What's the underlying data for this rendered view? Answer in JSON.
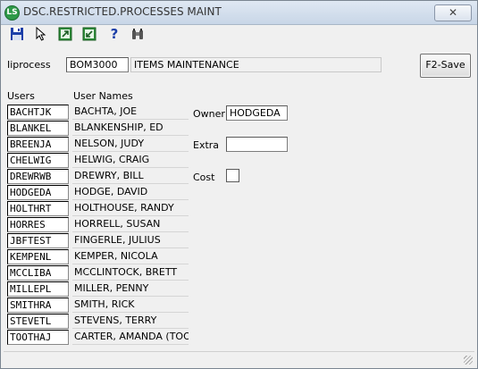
{
  "window": {
    "title": "DSC.RESTRICTED.PROCESSES MAINT",
    "app_icon_letter": "LS",
    "close_label": "✕"
  },
  "toolbar": {
    "icons": [
      "save-icon",
      "pointer-icon",
      "export-icon",
      "import-icon",
      "help-icon",
      "binoculars-icon"
    ],
    "help_glyph": "?"
  },
  "header": {
    "process_label": "Iiprocess",
    "process_value": "BOM3000",
    "process_desc": "ITEMS MAINTENANCE",
    "save_button": "F2-Save"
  },
  "grid": {
    "users_header": "Users",
    "names_header": "User Names",
    "rows": [
      {
        "user": "BACHTJK",
        "name": "BACHTA, JOE"
      },
      {
        "user": "BLANKEL",
        "name": "BLANKENSHIP, ED"
      },
      {
        "user": "BREENJA",
        "name": "NELSON, JUDY"
      },
      {
        "user": "CHELWIG",
        "name": "HELWIG, CRAIG"
      },
      {
        "user": "DREWRWB",
        "name": "DREWRY, BILL"
      },
      {
        "user": "HODGEDA",
        "name": "HODGE, DAVID"
      },
      {
        "user": "HOLTHRT",
        "name": "HOLTHOUSE, RANDY"
      },
      {
        "user": "HORRES",
        "name": "HORRELL, SUSAN"
      },
      {
        "user": "JBFTEST",
        "name": "FINGERLE, JULIUS"
      },
      {
        "user": "KEMPENL",
        "name": "KEMPER, NICOLA"
      },
      {
        "user": "MCCLIBA",
        "name": "MCCLINTOCK, BRETT"
      },
      {
        "user": "MILLEPL",
        "name": "MILLER, PENNY"
      },
      {
        "user": "SMITHRA",
        "name": "SMITH, RICK"
      },
      {
        "user": "STEVETL",
        "name": "STEVENS, TERRY"
      },
      {
        "user": "TOOTHAJ",
        "name": "CARTER, AMANDA (TOOT"
      }
    ]
  },
  "detail": {
    "owner_label": "Owner",
    "owner_value": "HODGEDA",
    "extra_label": "Extra",
    "extra_value": "",
    "cost_label": "Cost",
    "cost_checked": false
  }
}
